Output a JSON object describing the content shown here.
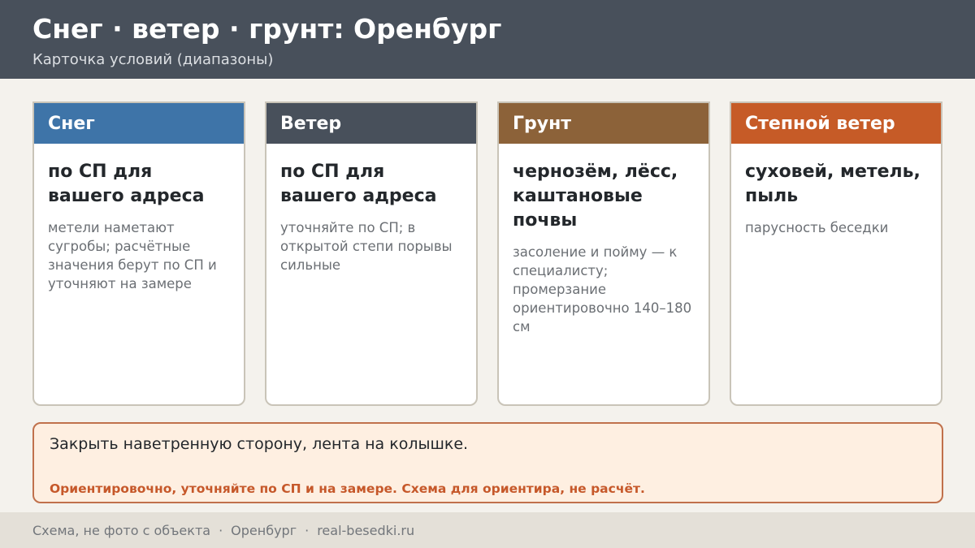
{
  "header": {
    "title": "Снег · ветер · грунт: Оренбург",
    "subtitle": "Карточка условий (диапазоны)"
  },
  "cards": [
    {
      "title": "Снег",
      "color": "#3e74a8",
      "main": "по СП для вашего адреса",
      "note": "метели наметают сугробы; расчётные значения берут по СП и уточняют на замере"
    },
    {
      "title": "Ветер",
      "color": "#48505b",
      "main": "по СП для вашего адреса",
      "note": "уточняйте по СП; в открытой степи порывы сильные"
    },
    {
      "title": "Грунт",
      "color": "#8c6239",
      "main": "чернозём, лёсс, каштановые почвы",
      "note": "засоление и пойму — к специалисту; промерзание ориентировочно 140–180 см"
    },
    {
      "title": "Степной ветер",
      "color": "#c65b27",
      "main": "суховей, метель, пыль",
      "note": "парусность беседки"
    }
  ],
  "note_box": {
    "text": "Закрыть наветренную сторону, лента на колышке.",
    "warning": "Ориентировочно, уточняйте по СП и на замере. Схема для ориентира, не расчёт."
  },
  "footer": {
    "source": "Схема, не фото с объекта",
    "city": "Оренбург",
    "site": "real-besedki.ru",
    "separator": "·"
  }
}
